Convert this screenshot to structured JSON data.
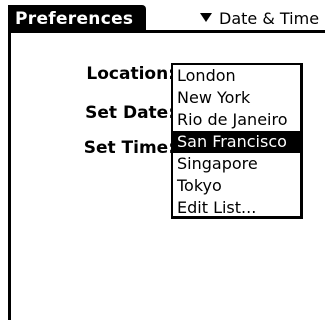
{
  "header": {
    "title": "Preferences",
    "category_label": "Date & Time",
    "category_icon": "triangle-down-icon"
  },
  "form": {
    "location_label": "Location:",
    "set_date_label": "Set Date:",
    "set_time_label": "Set Time:"
  },
  "dropdown": {
    "items": [
      "London",
      "New York",
      "Rio de Janeiro",
      "San Francisco",
      "Singapore",
      "Tokyo",
      "Edit List..."
    ],
    "selected": "San Francisco"
  }
}
